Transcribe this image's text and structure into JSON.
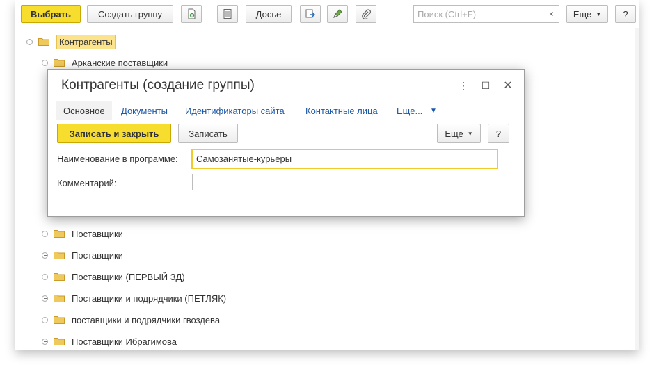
{
  "toolbar": {
    "select_label": "Выбрать",
    "create_group_label": "Создать группу",
    "dossier_label": "Досье",
    "search_placeholder": "Поиск (Ctrl+F)",
    "search_clear": "×",
    "more_label": "Еще",
    "help_label": "?",
    "icons": [
      "add-document-icon",
      "list-icon",
      "export-icon",
      "edit-icon",
      "attach-icon"
    ]
  },
  "tree": {
    "root": "Контрагенты",
    "items": [
      "Арканские поставщики",
      "Поставщики",
      "Поставщики",
      "Поставщики (ПЕРВЫЙ ЗД)",
      "Поставщики и подрядчики (ПЕТЛЯК)",
      "поставщики и подрядчики гвоздева",
      "Поставщики Ибрагимова"
    ]
  },
  "dialog": {
    "title": "Контрагенты (создание группы)",
    "tabs": [
      "Основное",
      "Документы",
      "Идентификаторы сайта",
      "Контактные лица",
      "Еще..."
    ],
    "save_close_label": "Записать и закрыть",
    "save_label": "Записать",
    "more_label": "Еще",
    "help_label": "?",
    "name_label": "Наименование в программе:",
    "name_value": "Самозанятые-курьеры",
    "comment_label": "Комментарий:",
    "comment_value": ""
  },
  "colors": {
    "primary_button": "#f6dd2e",
    "link": "#1c58a6",
    "selected_row": "#fbe28d"
  }
}
